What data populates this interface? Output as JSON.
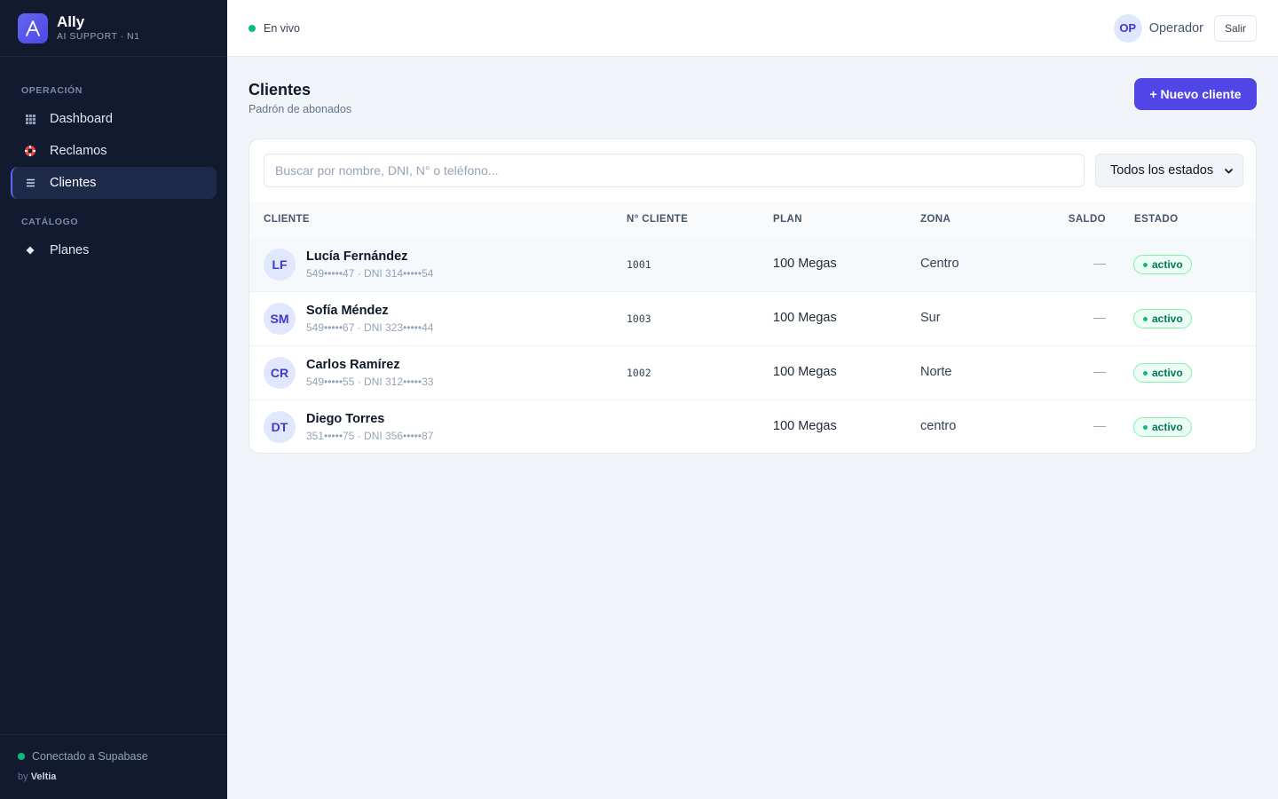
{
  "brand": {
    "name": "Ally",
    "subtitle": "AI SUPPORT · N1"
  },
  "sidebar": {
    "sections": [
      {
        "label": "OPERACIÓN",
        "items": [
          {
            "label": "Dashboard",
            "icon": "grid-icon"
          },
          {
            "label": "Reclamos",
            "icon": "lifebuoy-icon"
          },
          {
            "label": "Clientes",
            "icon": "list-icon",
            "active": true
          }
        ]
      },
      {
        "label": "CATÁLOGO",
        "items": [
          {
            "label": "Planes",
            "icon": "diamond-icon"
          }
        ]
      }
    ],
    "footer": {
      "status": "Conectado a Supabase",
      "by_prefix": "by",
      "by_name": "Veltia"
    }
  },
  "topbar": {
    "live": "En vivo",
    "user_initials": "OP",
    "user_name": "Operador",
    "logout": "Salir"
  },
  "page": {
    "title": "Clientes",
    "subtitle": "Padrón de abonados",
    "new_button": "+ Nuevo cliente"
  },
  "filters": {
    "search_placeholder": "Buscar por nombre, DNI, N° o teléfono...",
    "status_selected": "Todos los estados"
  },
  "table": {
    "columns": [
      "CLIENTE",
      "N° CLIENTE",
      "PLAN",
      "ZONA",
      "SALDO",
      "ESTADO"
    ],
    "rows": [
      {
        "initials": "LF",
        "name": "Lucía Fernández",
        "meta": "549•••••47 · DNI 314•••••54",
        "number": "1001",
        "plan": "100 Megas",
        "zone": "Centro",
        "balance": "—",
        "status": "activo"
      },
      {
        "initials": "SM",
        "name": "Sofía Méndez",
        "meta": "549•••••67 · DNI 323•••••44",
        "number": "1003",
        "plan": "100 Megas",
        "zone": "Sur",
        "balance": "—",
        "status": "activo"
      },
      {
        "initials": "CR",
        "name": "Carlos Ramírez",
        "meta": "549•••••55 · DNI 312•••••33",
        "number": "1002",
        "plan": "100 Megas",
        "zone": "Norte",
        "balance": "—",
        "status": "activo"
      },
      {
        "initials": "DT",
        "name": "Diego Torres",
        "meta": "351•••••75 · DNI 356•••••87",
        "number": "",
        "plan": "100 Megas",
        "zone": "centro",
        "balance": "—",
        "status": "activo"
      }
    ]
  },
  "colors": {
    "accent": "#4f46e5",
    "sidebar_bg": "#111a2e",
    "status_green": "#10b981"
  }
}
